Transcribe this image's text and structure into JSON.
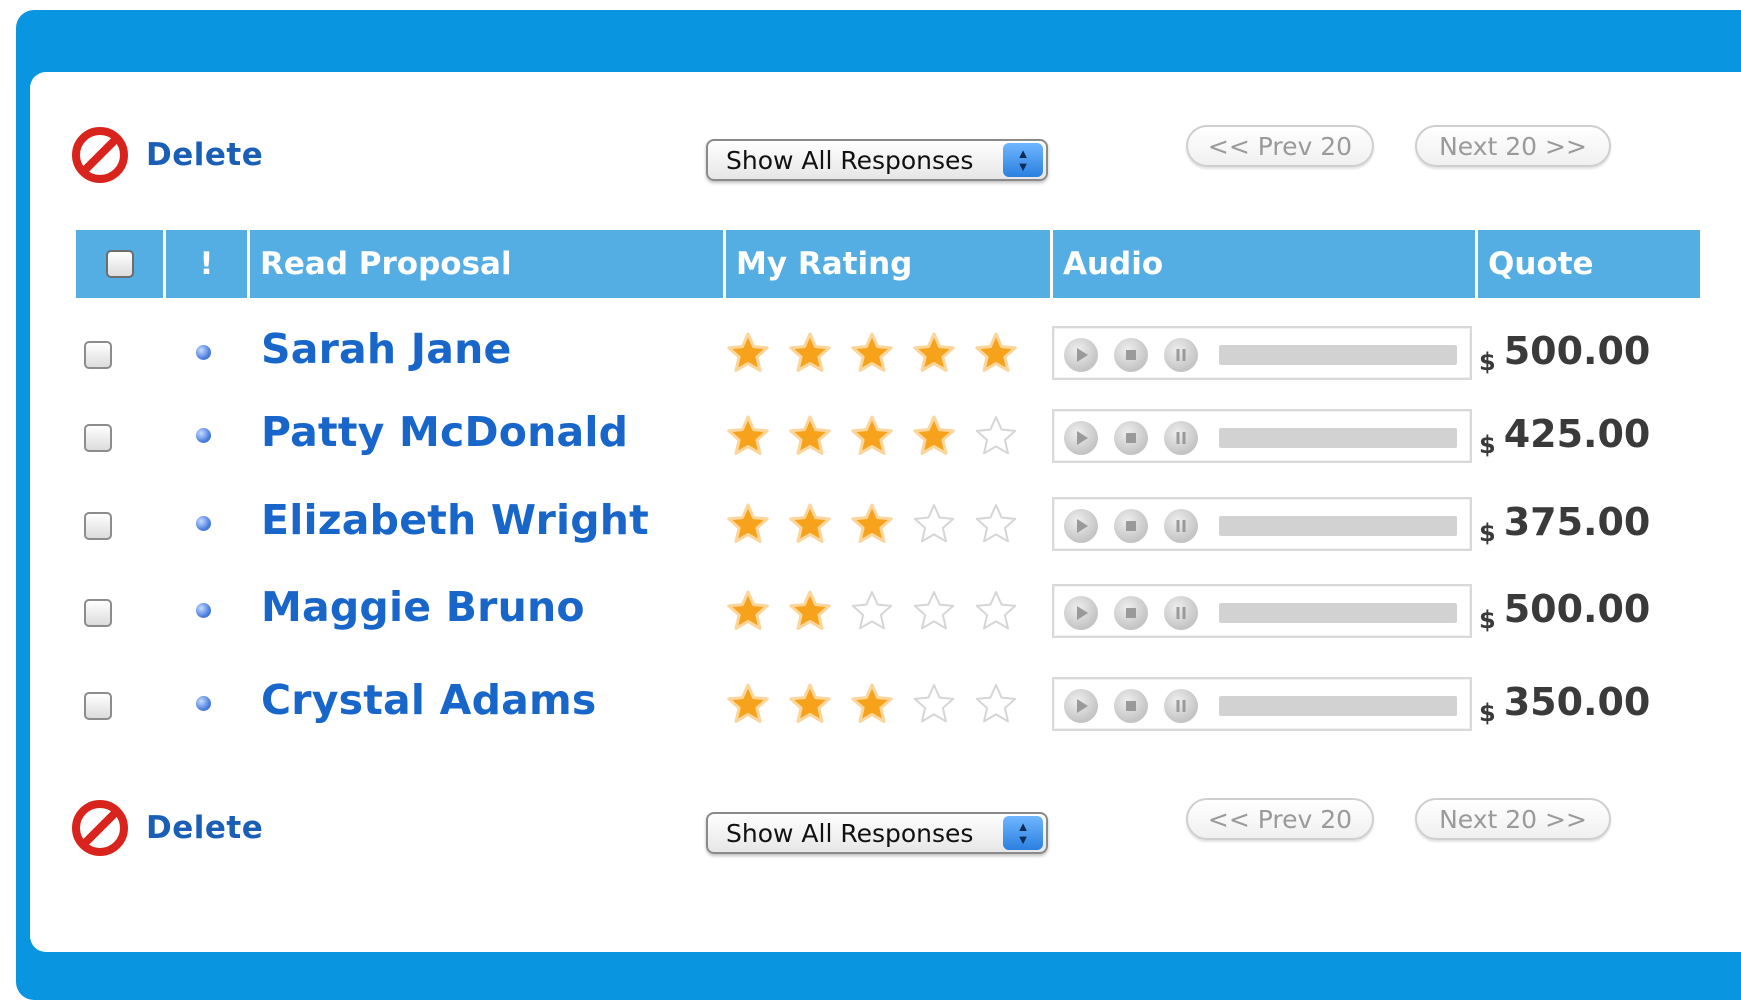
{
  "toolbar": {
    "delete_label": "Delete",
    "filter_value": "Show All Responses",
    "prev_label": "<< Prev 20",
    "next_label": "Next 20 >>"
  },
  "table": {
    "headers": {
      "flag": "!",
      "name": "Read Proposal",
      "rating": "My Rating",
      "audio": "Audio",
      "quote": "Quote"
    },
    "rating_max": 5,
    "currency": "$",
    "rows": [
      {
        "name": "Sarah Jane",
        "rating": 5,
        "quote": "500.00"
      },
      {
        "name": "Patty McDonald",
        "rating": 4,
        "quote": "425.00"
      },
      {
        "name": "Elizabeth Wright",
        "rating": 3,
        "quote": "375.00"
      },
      {
        "name": "Maggie Bruno",
        "rating": 2,
        "quote": "500.00"
      },
      {
        "name": "Crystal Adams",
        "rating": 3,
        "quote": "350.00"
      }
    ]
  },
  "icons": {
    "delete": "no-entry-icon",
    "unread": "dot-icon",
    "star": "star-icon",
    "play": "play-icon",
    "stop": "stop-icon",
    "pause": "pause-icon"
  },
  "colors": {
    "frame": "#0a95e0",
    "header": "#55aee3",
    "name_link": "#1866c9",
    "star_filled": "#f7a21b",
    "delete_icon": "#d8241c"
  }
}
